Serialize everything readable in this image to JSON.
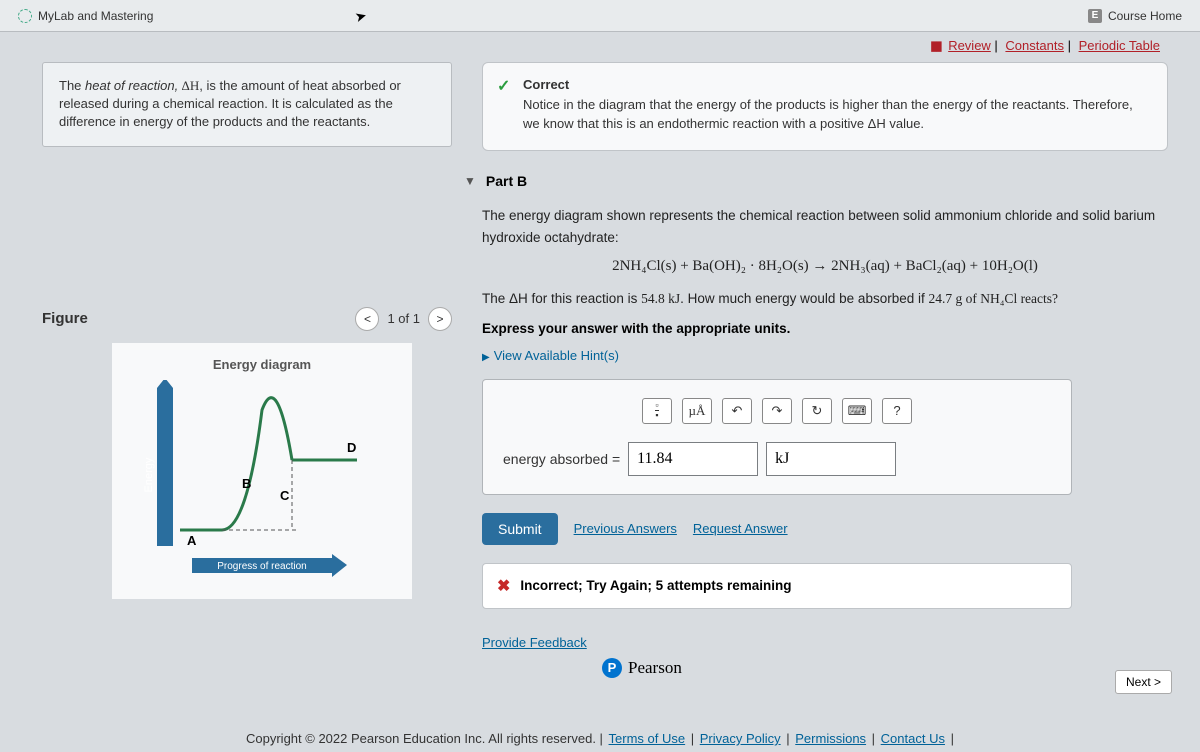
{
  "tabs": {
    "mylab": "MyLab and Mastering",
    "e_label": "E",
    "course": "Course Home"
  },
  "navlinks": {
    "review": "Review",
    "constants": "Constants",
    "periodic": "Periodic Table"
  },
  "intro": {
    "prefix": "The ",
    "italic1": "heat of reaction,",
    "delta": " ΔH",
    "rest": ", is the amount of heat absorbed or released during a chemical reaction. It is calculated as the difference in energy of the products and the reactants."
  },
  "figure": {
    "title": "Figure",
    "counter": "1 of 1",
    "diagram_title": "Energy diagram",
    "labels": {
      "a": "A",
      "b": "B",
      "c": "C",
      "d": "D",
      "yaxis": "Energy",
      "xaxis": "Progress of reaction"
    }
  },
  "correct": {
    "title": "Correct",
    "text": "Notice in the diagram that the energy of the products is higher than the energy of the reactants. Therefore, we know that this is an endothermic reaction with a positive ΔH value."
  },
  "partB": {
    "title": "Part B",
    "q1": "The energy diagram shown represents the chemical reaction between solid ammonium chloride and solid barium hydroxide octahydrate:",
    "equation": "2NH₄Cl(s) + Ba(OH)₂ · 8H₂O(s) → 2NH₃(aq) + BaCl₂(aq) + 10H₂O(l)",
    "q2_a": "The ΔH for this reaction is ",
    "q2_b": "54.8 kJ",
    "q2_c": ". How much energy would be absorbed if ",
    "q2_d": "24.7 g",
    "q2_e": " of NH₄Cl reacts?",
    "instruction": "Express your answer with the appropriate units.",
    "hints": "View Available Hint(s)",
    "mu_label": "µÅ",
    "help_q": "?",
    "label": "energy absorbed =",
    "value": "11.84",
    "unit": "kJ",
    "submit": "Submit",
    "prev": "Previous Answers",
    "req": "Request Answer",
    "feedback": "Incorrect; Try Again; 5 attempts remaining"
  },
  "footer": {
    "provide": "Provide Feedback",
    "brand": "Pearson",
    "next": "Next >",
    "copy": "Copyright © 2022 Pearson Education Inc. All rights reserved.",
    "terms": "Terms of Use",
    "privacy": "Privacy Policy",
    "perm": "Permissions",
    "contact": "Contact Us"
  }
}
